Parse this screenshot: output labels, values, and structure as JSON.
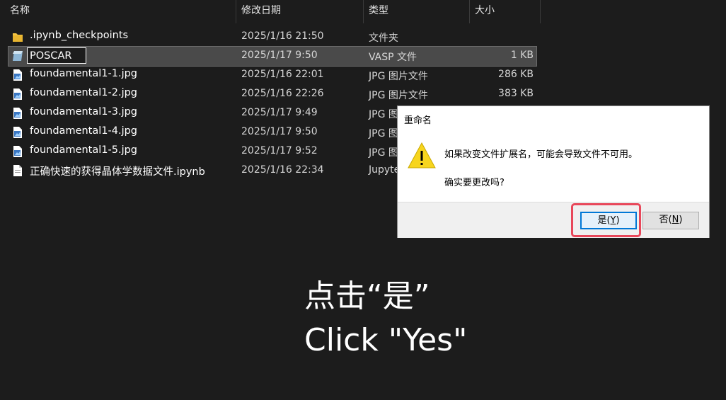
{
  "columns": {
    "name": "名称",
    "date": "修改日期",
    "type": "类型",
    "size": "大小"
  },
  "files": [
    {
      "icon": "folder-icon",
      "name": ".ipynb_checkpoints",
      "date": "2025/1/16 21:50",
      "type": "文件夹",
      "size": ""
    },
    {
      "icon": "vasp-file-icon",
      "name": "POSCAR",
      "date": "2025/1/17 9:50",
      "type": "VASP 文件",
      "size": "1 KB",
      "selected": true,
      "renaming": true
    },
    {
      "icon": "image-file-icon",
      "name": "foundamental1-1.jpg",
      "date": "2025/1/16 22:01",
      "type": "JPG 图片文件",
      "size": "286 KB"
    },
    {
      "icon": "image-file-icon",
      "name": "foundamental1-2.jpg",
      "date": "2025/1/16 22:26",
      "type": "JPG 图片文件",
      "size": "383 KB"
    },
    {
      "icon": "image-file-icon",
      "name": "foundamental1-3.jpg",
      "date": "2025/1/17 9:49",
      "type": "JPG 图",
      "size": ""
    },
    {
      "icon": "image-file-icon",
      "name": "foundamental1-4.jpg",
      "date": "2025/1/17 9:50",
      "type": "JPG 图",
      "size": ""
    },
    {
      "icon": "image-file-icon",
      "name": "foundamental1-5.jpg",
      "date": "2025/1/17 9:52",
      "type": "JPG 图",
      "size": ""
    },
    {
      "icon": "document-file-icon",
      "name": "正确快速的获得晶体学数据文件.ipynb",
      "date": "2025/1/16 22:34",
      "type": "Jupyte",
      "size": ""
    }
  ],
  "rename_value": "POSCAR",
  "dialog": {
    "title": "重命名",
    "message_1": "如果改变文件扩展名，可能会导致文件不可用。",
    "message_2": "确实要更改吗?",
    "yes_label": "是(",
    "yes_key": "Y",
    "yes_close": ")",
    "no_label": "否(",
    "no_key": "N",
    "no_close": ")"
  },
  "caption": {
    "line1": "点击“是”",
    "line2": "Click \"Yes\""
  },
  "colors": {
    "background": "#1c1c1c",
    "selection": "#4a4a4a",
    "highlight": "#e8475a",
    "yes_button_border": "#0078d7",
    "warning": "#f7d51d"
  }
}
